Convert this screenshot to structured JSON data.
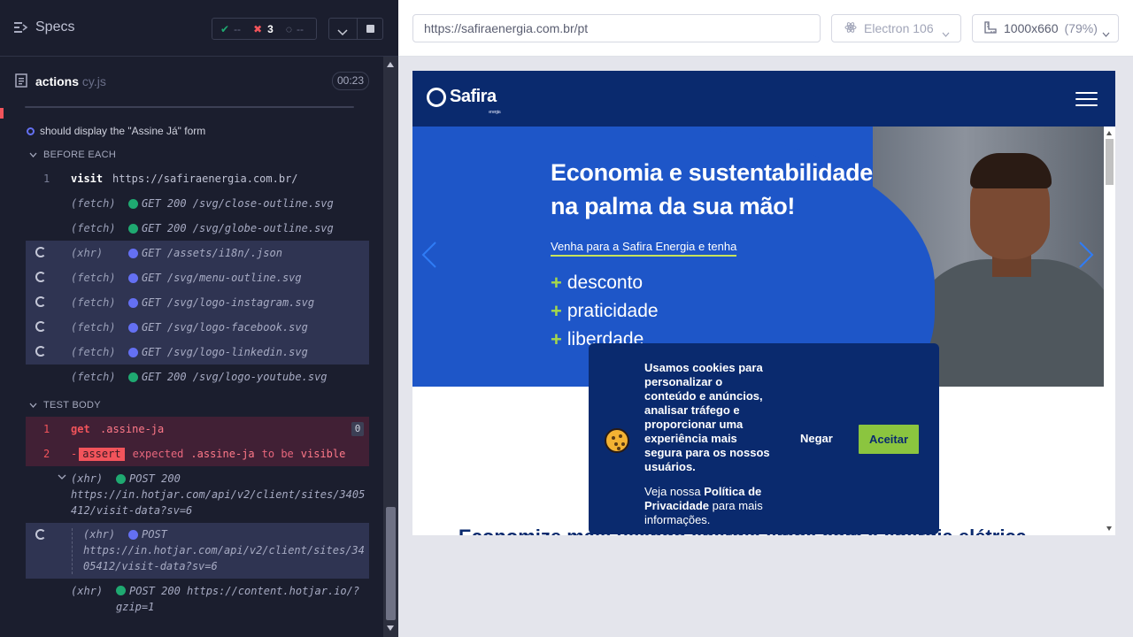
{
  "specs": {
    "label": "Specs"
  },
  "stats": {
    "passed": "--",
    "failed": "3",
    "pending": "--"
  },
  "file": {
    "name": "actions",
    "ext": " cy.js",
    "timer": "00:23"
  },
  "test": {
    "title": "should display the \"Assine Já\" form"
  },
  "sections": {
    "before_each": "BEFORE EACH",
    "test_body": "TEST BODY"
  },
  "before_each": [
    {
      "num": "1",
      "name": "visit",
      "message": "https://safiraenergia.com.br/",
      "status": "plain"
    },
    {
      "num": "",
      "name": "(fetch)",
      "message": "GET 200 /svg/close-outline.svg",
      "status": "done"
    },
    {
      "num": "",
      "name": "(fetch)",
      "message": "GET 200 /svg/globe-outline.svg",
      "status": "done"
    },
    {
      "num": "",
      "name": "(xhr)",
      "message": "GET /assets/i18n/.json",
      "status": "pending"
    },
    {
      "num": "",
      "name": "(fetch)",
      "message": "GET /svg/menu-outline.svg",
      "status": "pending"
    },
    {
      "num": "",
      "name": "(fetch)",
      "message": "GET /svg/logo-instagram.svg",
      "status": "pending"
    },
    {
      "num": "",
      "name": "(fetch)",
      "message": "GET /svg/logo-facebook.svg",
      "status": "pending"
    },
    {
      "num": "",
      "name": "(fetch)",
      "message": "GET /svg/logo-linkedin.svg",
      "status": "pending"
    },
    {
      "num": "",
      "name": "(fetch)",
      "message": "GET 200 /svg/logo-youtube.svg",
      "status": "done"
    }
  ],
  "test_body": {
    "get": {
      "num": "1",
      "name": "get",
      "selector": ".assine-ja",
      "count": "0"
    },
    "assert": {
      "num": "2",
      "prefix": "-",
      "badge": "assert",
      "w1": "expected",
      "selector": ".assine-ja",
      "w2": "to be",
      "w3": "visible"
    },
    "xhr1": {
      "name": "(xhr)",
      "message": "POST 200",
      "url": "https://in.hotjar.com/api/v2/client/sites/3405412/visit-data?sv=6"
    },
    "xhr2": {
      "name": "(xhr)",
      "message": "POST",
      "url": "https://in.hotjar.com/api/v2/client/sites/3405412/visit-data?sv=6"
    },
    "xhr3": {
      "name": "(xhr)",
      "message": "POST 200 https://content.hotjar.io/?gzip=1"
    }
  },
  "toolbar": {
    "url": "https://safiraenergia.com.br/pt",
    "browser": "Electron 106",
    "viewport": "1000x660",
    "zoom": "(79%)"
  },
  "app": {
    "logo": "Safira",
    "logo_small": "energia",
    "hero_title_1": "Economia e sustentabilidade",
    "hero_title_2": "na palma da sua mão!",
    "hero_sub": "Venha para a Safira Energia e tenha",
    "hero_items": [
      "desconto",
      "praticidade",
      "liberdade"
    ],
    "below_title": "Economize mais usando energia limpa com a energia elétrica"
  },
  "cookie": {
    "text": "Usamos cookies para personalizar o conteúdo e anúncios, analisar tráfego e proporcionar uma experiência mais segura para os nossos usuários.",
    "note_pre": "Veja nossa ",
    "note_link": "Política de Privacidade",
    "note_post": " para mais informações.",
    "deny": "Negar",
    "accept": "Aceitar"
  },
  "colors": {
    "panel": "#1b1e2e",
    "pass": "#1fa971",
    "fail": "#f2545b",
    "pending": "#6470f3",
    "brand": "#0a2a6e",
    "accent": "#8bc53f"
  }
}
